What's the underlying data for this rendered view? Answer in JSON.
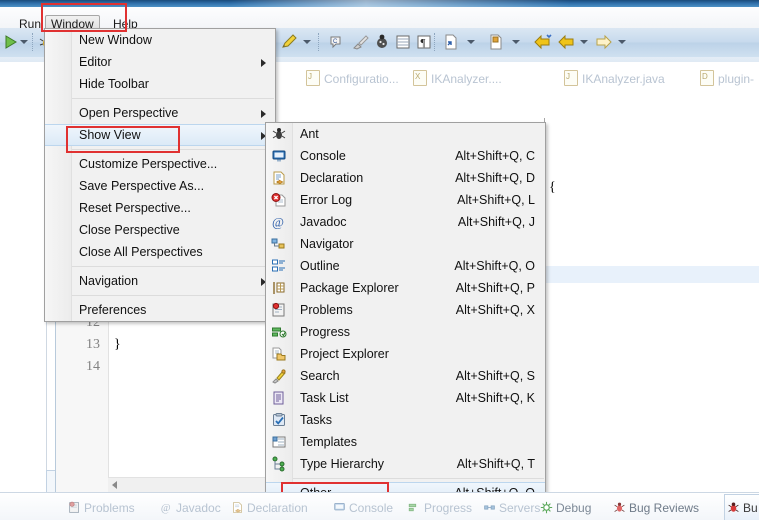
{
  "window": {
    "menubar": [
      {
        "label": "Run",
        "active": false
      },
      {
        "label": "Window",
        "active": true
      },
      {
        "label": "Help",
        "active": false
      }
    ]
  },
  "colors": {
    "titlebar": "#2f6ea8",
    "toolbar": "#c7daed",
    "menu_bg": "#f1f1f1",
    "menu_highlight": "#dceaf7",
    "annotation_red": "#e03131",
    "tab_inactive_text": "#b9c4d2",
    "selected_line": "#e8f1fb"
  },
  "window_menu": {
    "name": "Window",
    "items": [
      {
        "label": "New Window",
        "accel": "",
        "submenu": false
      },
      {
        "label": "Editor",
        "accel": "",
        "submenu": true
      },
      {
        "label": "Hide Toolbar",
        "accel": "",
        "submenu": false
      },
      {
        "separator": true
      },
      {
        "label": "Open Perspective",
        "accel": "",
        "submenu": true
      },
      {
        "label": "Show View",
        "accel": "",
        "submenu": true,
        "highlighted": true,
        "annotated": true
      },
      {
        "separator": true
      },
      {
        "label": "Customize Perspective...",
        "accel": "",
        "submenu": false
      },
      {
        "label": "Save Perspective As...",
        "accel": "",
        "submenu": false
      },
      {
        "label": "Reset Perspective...",
        "accel": "",
        "submenu": false
      },
      {
        "label": "Close Perspective",
        "accel": "",
        "submenu": false
      },
      {
        "label": "Close All Perspectives",
        "accel": "",
        "submenu": false
      },
      {
        "separator": true
      },
      {
        "label": "Navigation",
        "accel": "",
        "submenu": true
      },
      {
        "separator": true
      },
      {
        "label": "Preferences",
        "accel": "",
        "submenu": false
      }
    ]
  },
  "show_view_menu": {
    "items": [
      {
        "label": "Ant",
        "accel": "",
        "icon": "ant-icon"
      },
      {
        "label": "Console",
        "accel": "Alt+Shift+Q, C",
        "icon": "console-icon"
      },
      {
        "label": "Declaration",
        "accel": "Alt+Shift+Q, D",
        "icon": "declaration-icon"
      },
      {
        "label": "Error Log",
        "accel": "Alt+Shift+Q, L",
        "icon": "error-log-icon"
      },
      {
        "label": "Javadoc",
        "accel": "Alt+Shift+Q, J",
        "icon": "javadoc-icon"
      },
      {
        "label": "Navigator",
        "accel": "",
        "icon": "navigator-icon"
      },
      {
        "label": "Outline",
        "accel": "Alt+Shift+Q, O",
        "icon": "outline-icon"
      },
      {
        "label": "Package Explorer",
        "accel": "Alt+Shift+Q, P",
        "icon": "package-explorer-icon"
      },
      {
        "label": "Problems",
        "accel": "Alt+Shift+Q, X",
        "icon": "problems-icon"
      },
      {
        "label": "Progress",
        "accel": "",
        "icon": "progress-icon"
      },
      {
        "label": "Project Explorer",
        "accel": "",
        "icon": "project-explorer-icon"
      },
      {
        "label": "Search",
        "accel": "Alt+Shift+Q, S",
        "icon": "search-icon"
      },
      {
        "label": "Task List",
        "accel": "Alt+Shift+Q, K",
        "icon": "task-list-icon"
      },
      {
        "label": "Tasks",
        "accel": "",
        "icon": "tasks-icon"
      },
      {
        "label": "Templates",
        "accel": "",
        "icon": "templates-icon"
      },
      {
        "label": "Type Hierarchy",
        "accel": "Alt+Shift+Q, T",
        "icon": "type-hierarchy-icon"
      }
    ],
    "other": {
      "label": "Other...",
      "accel": "Alt+Shift+Q, Q",
      "highlighted": true,
      "annotated": true
    }
  },
  "editor_tabs": [
    {
      "label": "Configuratio...",
      "badge": "J"
    },
    {
      "label": "IKAnalyzer....",
      "badge": "X"
    },
    {
      "label": "IKAnalyzer.java",
      "badge": "J"
    },
    {
      "label": "plugin-",
      "badge": "D"
    }
  ],
  "editor": {
    "line_numbers": [
      "12",
      "13",
      "14"
    ],
    "code_lines": [
      "",
      "}",
      ""
    ],
    "fragment_semicolon": ";",
    "fragment_brace": "{"
  },
  "bottom_tabs": [
    {
      "label": "Problems",
      "icon": "problems-icon",
      "selected": false
    },
    {
      "label": "Javadoc",
      "icon": "javadoc-icon",
      "selected": false
    },
    {
      "label": "Declaration",
      "icon": "declaration-icon",
      "selected": false
    },
    {
      "label": "Console",
      "icon": "console-icon",
      "selected": false
    },
    {
      "label": "Progress",
      "icon": "progress-icon",
      "selected": false
    },
    {
      "label": "Servers",
      "icon": "servers-icon",
      "selected": false
    },
    {
      "label": "Debug",
      "icon": "debug-icon",
      "selected": false
    },
    {
      "label": "Bug Reviews",
      "icon": "bug-icon",
      "selected": false
    },
    {
      "label": "Bu",
      "icon": "bug-icon",
      "selected": true
    }
  ]
}
